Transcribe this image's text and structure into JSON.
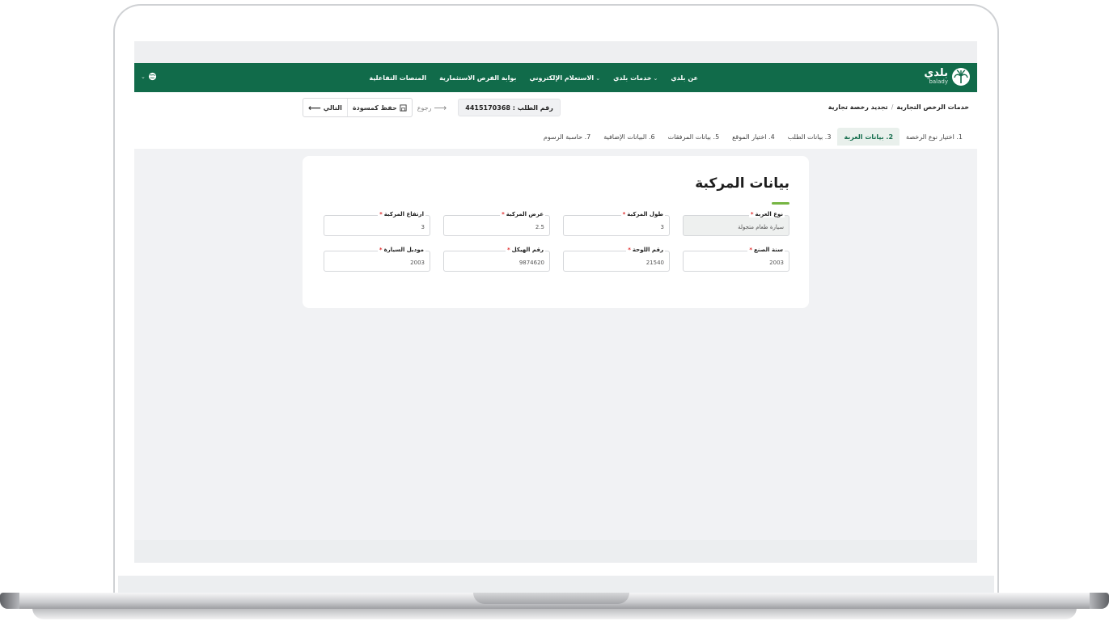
{
  "navbar": {
    "logo_text": "بلدي",
    "logo_sub": "balady",
    "links": [
      {
        "label": "عن بلدي",
        "has_caret": false
      },
      {
        "label": "خدمات بلدي",
        "has_caret": true
      },
      {
        "label": "الاستعلام الإلكتروني",
        "has_caret": true
      },
      {
        "label": "بوابة الفرص الاستثمارية",
        "has_caret": false
      },
      {
        "label": "المنصات التفاعلية",
        "has_caret": false
      }
    ],
    "caret_glyph": "⌄"
  },
  "breadcrumb": {
    "items": [
      "خدمات الرخص التجارية",
      "تجديد رخصة تجارية"
    ],
    "separator": "/"
  },
  "actions": {
    "request_number_label": "رقم الطلب : 4415170368",
    "back_label": "رجوع",
    "save_draft_label": "حفظ كمسودة",
    "next_label": "التالي"
  },
  "steps": [
    {
      "label": "1. اختيار نوع الرخصة",
      "active": false
    },
    {
      "label": "2. بيانات العربة",
      "active": true
    },
    {
      "label": "3. بيانات الطلب",
      "active": false
    },
    {
      "label": "4. اختيار الموقع",
      "active": false
    },
    {
      "label": "5. بيانات المرفقات",
      "active": false
    },
    {
      "label": "6. البيانات الإضافية",
      "active": false
    },
    {
      "label": "7. حاسبة الرسوم",
      "active": false
    }
  ],
  "card": {
    "title": "بيانات المركبة",
    "fields": [
      {
        "label": "نوع العربة",
        "value": "سيارة طعام متجولة",
        "required": true,
        "disabled": true
      },
      {
        "label": "طول المركبة",
        "value": "3",
        "required": true,
        "disabled": false
      },
      {
        "label": "عرض المركبة",
        "value": "2.5",
        "required": true,
        "disabled": false
      },
      {
        "label": "ارتفاع المركبة",
        "value": "3",
        "required": true,
        "disabled": false
      },
      {
        "label": "سنة الصنع",
        "value": "2003",
        "required": true,
        "disabled": false
      },
      {
        "label": "رقم اللوحة",
        "value": "21540",
        "required": true,
        "disabled": false
      },
      {
        "label": "رقم الهيكل",
        "value": "9874620",
        "required": true,
        "disabled": false
      },
      {
        "label": "موديل السيارة",
        "value": "2003",
        "required": true,
        "disabled": false
      }
    ],
    "required_mark": "*"
  },
  "colors": {
    "brand_green": "#116b4a",
    "accent_green": "#76b543",
    "required_red": "#e02b2b"
  }
}
